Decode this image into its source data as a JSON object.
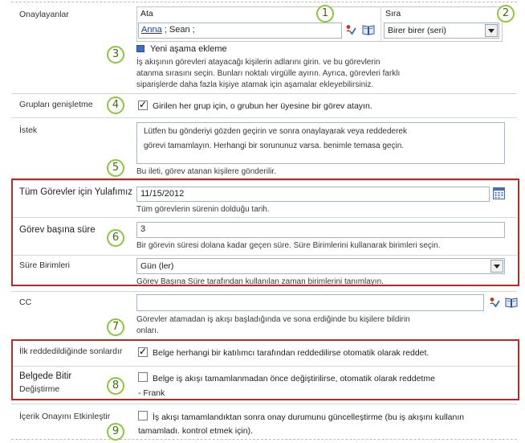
{
  "approvers": {
    "label": "Onaylayanlar",
    "col_assign": "Ata",
    "col_order": "Sıra",
    "names_resolved": "Anna",
    "names_rest": " ; Sean ;",
    "order_value": "Birer birer (seri)",
    "add_stage": "Yeni aşama ekleme",
    "description": [
      "İş akışının görevleri atayacağı kişilerin adlarını girin. ve bu görevlerin",
      "atanma sırasını seçin. Bunları noktalı virgülle ayırın. Ayrıca, görevleri farklı",
      "siparişlerde daha fazla kişiye atamak için aşamalar ekleyebilirsiniz."
    ]
  },
  "group_expand": {
    "label": "Grupları genişletme",
    "checkbox_text": "Girilen her grup için, o grubun her üyesine bir görev atayın.",
    "checked": true
  },
  "request": {
    "label": "İstek",
    "text_lines": [
      "Lütfen bu gönderiyi gözden geçirin ve sonra onaylayarak veya reddederek",
      "görevi tamamlayın. Herhangi bir sorununuz varsa. benimle temasa geçin."
    ],
    "description": "Bu ileti, görev atanan kişilere gönderilir."
  },
  "due_date": {
    "label": "Tüm Görevler için Yulafımız",
    "value": "11/15/2012",
    "description": "Tüm görevlerin sürenin dolduğu tarih."
  },
  "duration": {
    "label": "Görev başına süre",
    "value": "3",
    "description": "Bir görevin süresi dolana kadar geçen süre. Süre Birimlerini kullanarak birimleri seçin."
  },
  "duration_units": {
    "label": "Süre Birimleri",
    "value": "Gün (ler)",
    "description": "Görev Başına Süre tarafından kullanılan zaman birimlerini tanımlayın."
  },
  "cc": {
    "label": "CC",
    "value": "",
    "description": [
      "Görevler atamadan iş akışı başladığında ve sona erdiğinde bu kişilere bildirin",
      "onları."
    ]
  },
  "end_on_reject": {
    "label": "İlk reddedildiğinde sonlardır",
    "checkbox_text": "Belge herhangi bir katılımcı tarafından reddedilirse otomatik olarak reddet.",
    "checked": true
  },
  "end_on_change": {
    "label_line1": "Belgede Bitir",
    "label_line2": "Değiştirme",
    "checkbox_text": "Belge iş akışı tamamlanmadan önce değiştirilirse, otomatik olarak reddetme",
    "extra": "- Frank",
    "checked": false
  },
  "content_approval": {
    "label": "İçerik Onayını Etkinleştir",
    "checkbox_text": "İş akışı tamamlandıktan sonra onay durumunu güncelleştirme (bu iş akışını kullanın",
    "checkbox_text2": "tamamladı. kontrol etmek için).",
    "checked": false
  },
  "callouts": [
    "1",
    "2",
    "3",
    "4",
    "5",
    "6",
    "7",
    "8",
    "9"
  ],
  "colors": {
    "callout_border": "#8cc63f",
    "highlight_box": "#b52a2a",
    "link_blue": "#1a3d8f"
  }
}
